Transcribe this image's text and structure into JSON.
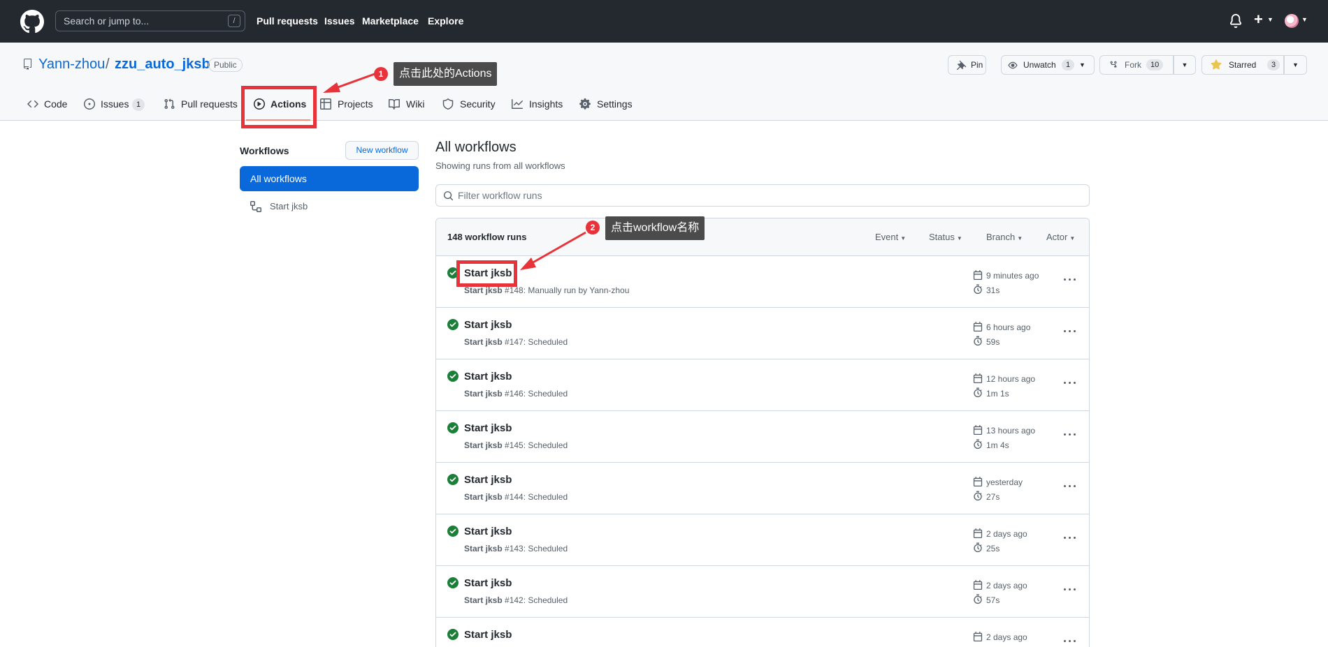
{
  "header": {
    "search_placeholder": "Search or jump to...",
    "search_shortcut": "/",
    "nav": [
      "Pull requests",
      "Issues",
      "Marketplace",
      "Explore"
    ]
  },
  "repo": {
    "owner": "Yann-zhou",
    "separator": "/",
    "name": "zzu_auto_jksb",
    "visibility": "Public",
    "pin_label": "Pin",
    "unwatch_label": "Unwatch",
    "unwatch_count": "1",
    "fork_label": "Fork",
    "fork_count": "10",
    "starred_label": "Starred",
    "star_count": "3"
  },
  "tabs": [
    {
      "label": "Code"
    },
    {
      "label": "Issues",
      "count": "1"
    },
    {
      "label": "Pull requests"
    },
    {
      "label": "Actions",
      "active": true
    },
    {
      "label": "Projects"
    },
    {
      "label": "Wiki"
    },
    {
      "label": "Security"
    },
    {
      "label": "Insights"
    },
    {
      "label": "Settings"
    }
  ],
  "annotations": {
    "step1_num": "1",
    "step1_text": "点击此处的Actions",
    "step2_num": "2",
    "step2_text": "点击workflow名称",
    "color": "#e8333a"
  },
  "sidebar": {
    "title": "Workflows",
    "new_workflow": "New workflow",
    "active_item": "All workflows",
    "items": [
      "Start jksb"
    ]
  },
  "main": {
    "title": "All workflows",
    "subtitle": "Showing runs from all workflows",
    "filter_placeholder": "Filter workflow runs",
    "runs_count": "148 workflow runs",
    "filters": [
      "Event",
      "Status",
      "Branch",
      "Actor"
    ]
  },
  "runs": [
    {
      "title": "Start jksb",
      "workflow": "Start jksb",
      "number": "#148",
      "trigger": ": Manually run by Yann-zhou",
      "when": "9 minutes ago",
      "duration": "31s"
    },
    {
      "title": "Start jksb",
      "workflow": "Start jksb",
      "number": "#147",
      "trigger": ": Scheduled",
      "when": "6 hours ago",
      "duration": "59s"
    },
    {
      "title": "Start jksb",
      "workflow": "Start jksb",
      "number": "#146",
      "trigger": ": Scheduled",
      "when": "12 hours ago",
      "duration": "1m 1s"
    },
    {
      "title": "Start jksb",
      "workflow": "Start jksb",
      "number": "#145",
      "trigger": ": Scheduled",
      "when": "13 hours ago",
      "duration": "1m 4s"
    },
    {
      "title": "Start jksb",
      "workflow": "Start jksb",
      "number": "#144",
      "trigger": ": Scheduled",
      "when": "yesterday",
      "duration": "27s"
    },
    {
      "title": "Start jksb",
      "workflow": "Start jksb",
      "number": "#143",
      "trigger": ": Scheduled",
      "when": "2 days ago",
      "duration": "25s"
    },
    {
      "title": "Start jksb",
      "workflow": "Start jksb",
      "number": "#142",
      "trigger": ": Scheduled",
      "when": "2 days ago",
      "duration": "57s"
    },
    {
      "title": "Start jksb",
      "workflow": "",
      "number": "",
      "trigger": "",
      "when": "2 days ago",
      "duration": ""
    }
  ],
  "colors": {
    "header_bg": "#24292f",
    "accent": "#0969da",
    "success": "#1a7f37",
    "tab_underline": "#fd8c73"
  }
}
